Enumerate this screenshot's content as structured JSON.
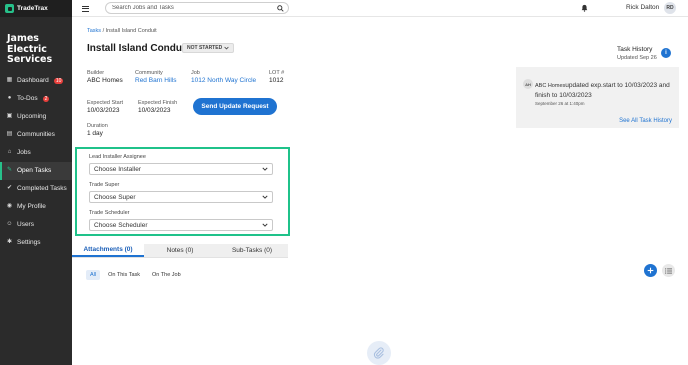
{
  "brand": {
    "name": "TradeTrax",
    "accent_color": "#27c08a"
  },
  "company": {
    "line1": "James",
    "line2": "Electric",
    "line3": "Services"
  },
  "nav": [
    {
      "label": "Dashboard",
      "icon": "dashboard-icon",
      "badge": "10"
    },
    {
      "label": "To-Dos",
      "icon": "todo-icon",
      "badge": "2"
    },
    {
      "label": "Upcoming",
      "icon": "calendar-icon",
      "badge": ""
    },
    {
      "label": "Communities",
      "icon": "communities-icon",
      "badge": ""
    },
    {
      "label": "Jobs",
      "icon": "home-icon",
      "badge": ""
    },
    {
      "label": "Open Tasks",
      "icon": "wrench-icon",
      "badge": ""
    },
    {
      "label": "Completed Tasks",
      "icon": "check-circle-icon",
      "badge": ""
    },
    {
      "label": "My Profile",
      "icon": "profile-icon",
      "badge": ""
    },
    {
      "label": "Users",
      "icon": "users-icon",
      "badge": ""
    },
    {
      "label": "Settings",
      "icon": "gear-icon",
      "badge": ""
    }
  ],
  "topbar": {
    "search_placeholder": "Search Jobs and Tasks",
    "user_name": "Rick Dalton",
    "user_initials": "RD"
  },
  "breadcrumb": {
    "root": "Tasks",
    "separator": "/",
    "current": "Install Island Conduit"
  },
  "task": {
    "title": "Install Island Conduit",
    "status": "NOT STARTED",
    "builder_label": "Builder",
    "builder": "ABC Homes",
    "community_label": "Community",
    "community": "Red Barn Hills",
    "job_label": "Job",
    "job": "1012 North Way Circle",
    "lot_label": "LOT #",
    "lot": "1012",
    "expected_start_label": "Expected Start",
    "expected_start": "10/03/2023",
    "expected_finish_label": "Expected Finish",
    "expected_finish": "10/03/2023",
    "duration_label": "Duration",
    "duration": "1 day",
    "update_button": "Send Update Request"
  },
  "assignees": {
    "installer_label": "Lead Installer Assignee",
    "installer_value": "Choose Installer",
    "super_label": "Trade Super",
    "super_value": "Choose Super",
    "scheduler_label": "Trade Scheduler",
    "scheduler_value": "Choose Scheduler",
    "highlight_color": "#1fc28a"
  },
  "tabs": [
    "Attachments (0)",
    "Notes (0)",
    "Sub-Tasks (0)"
  ],
  "filters": [
    "All",
    "On This Task",
    "On The Job"
  ],
  "history": {
    "title": "Task History",
    "updated": "Updated Sep 26",
    "avatar": "AH",
    "actor": "ABC Homes",
    "text": "updated exp.start to 10/03/2023 and finish to 10/03/2023",
    "date": "September 26 at 1:40pm",
    "see_all": "See All Task History"
  },
  "colors": {
    "primary": "#1f73d1",
    "sidebar": "#2b2b2b"
  }
}
